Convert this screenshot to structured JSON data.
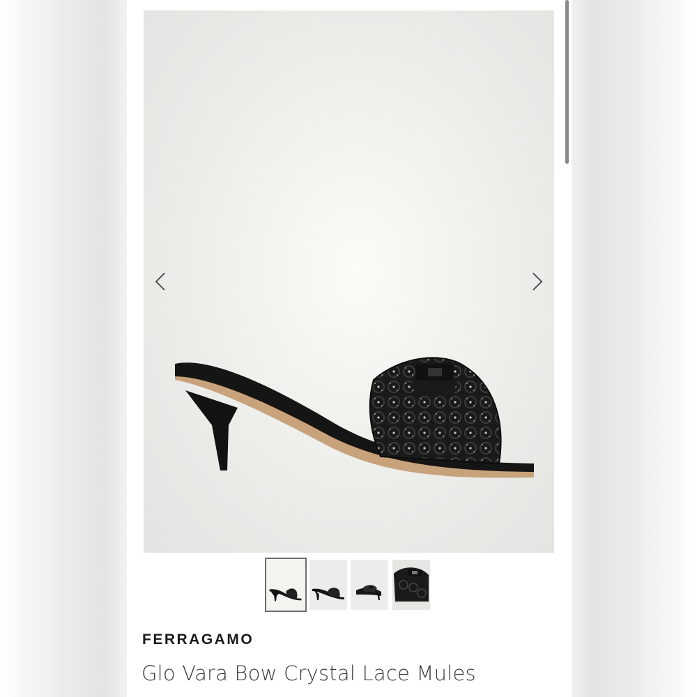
{
  "product": {
    "brand": "FERRAGAMO",
    "title": "Glo Vara Bow Crystal Lace Mules"
  },
  "gallery": {
    "prev_icon": "chevron-left-icon",
    "next_icon": "chevron-right-icon",
    "thumbnail_count": 4,
    "active_thumbnail": 1
  },
  "colors": {
    "hero_background": "#e9e9e6",
    "shoe": "#151515",
    "sole": "#c8a27a",
    "thumb_border": "#6c6c6c"
  }
}
